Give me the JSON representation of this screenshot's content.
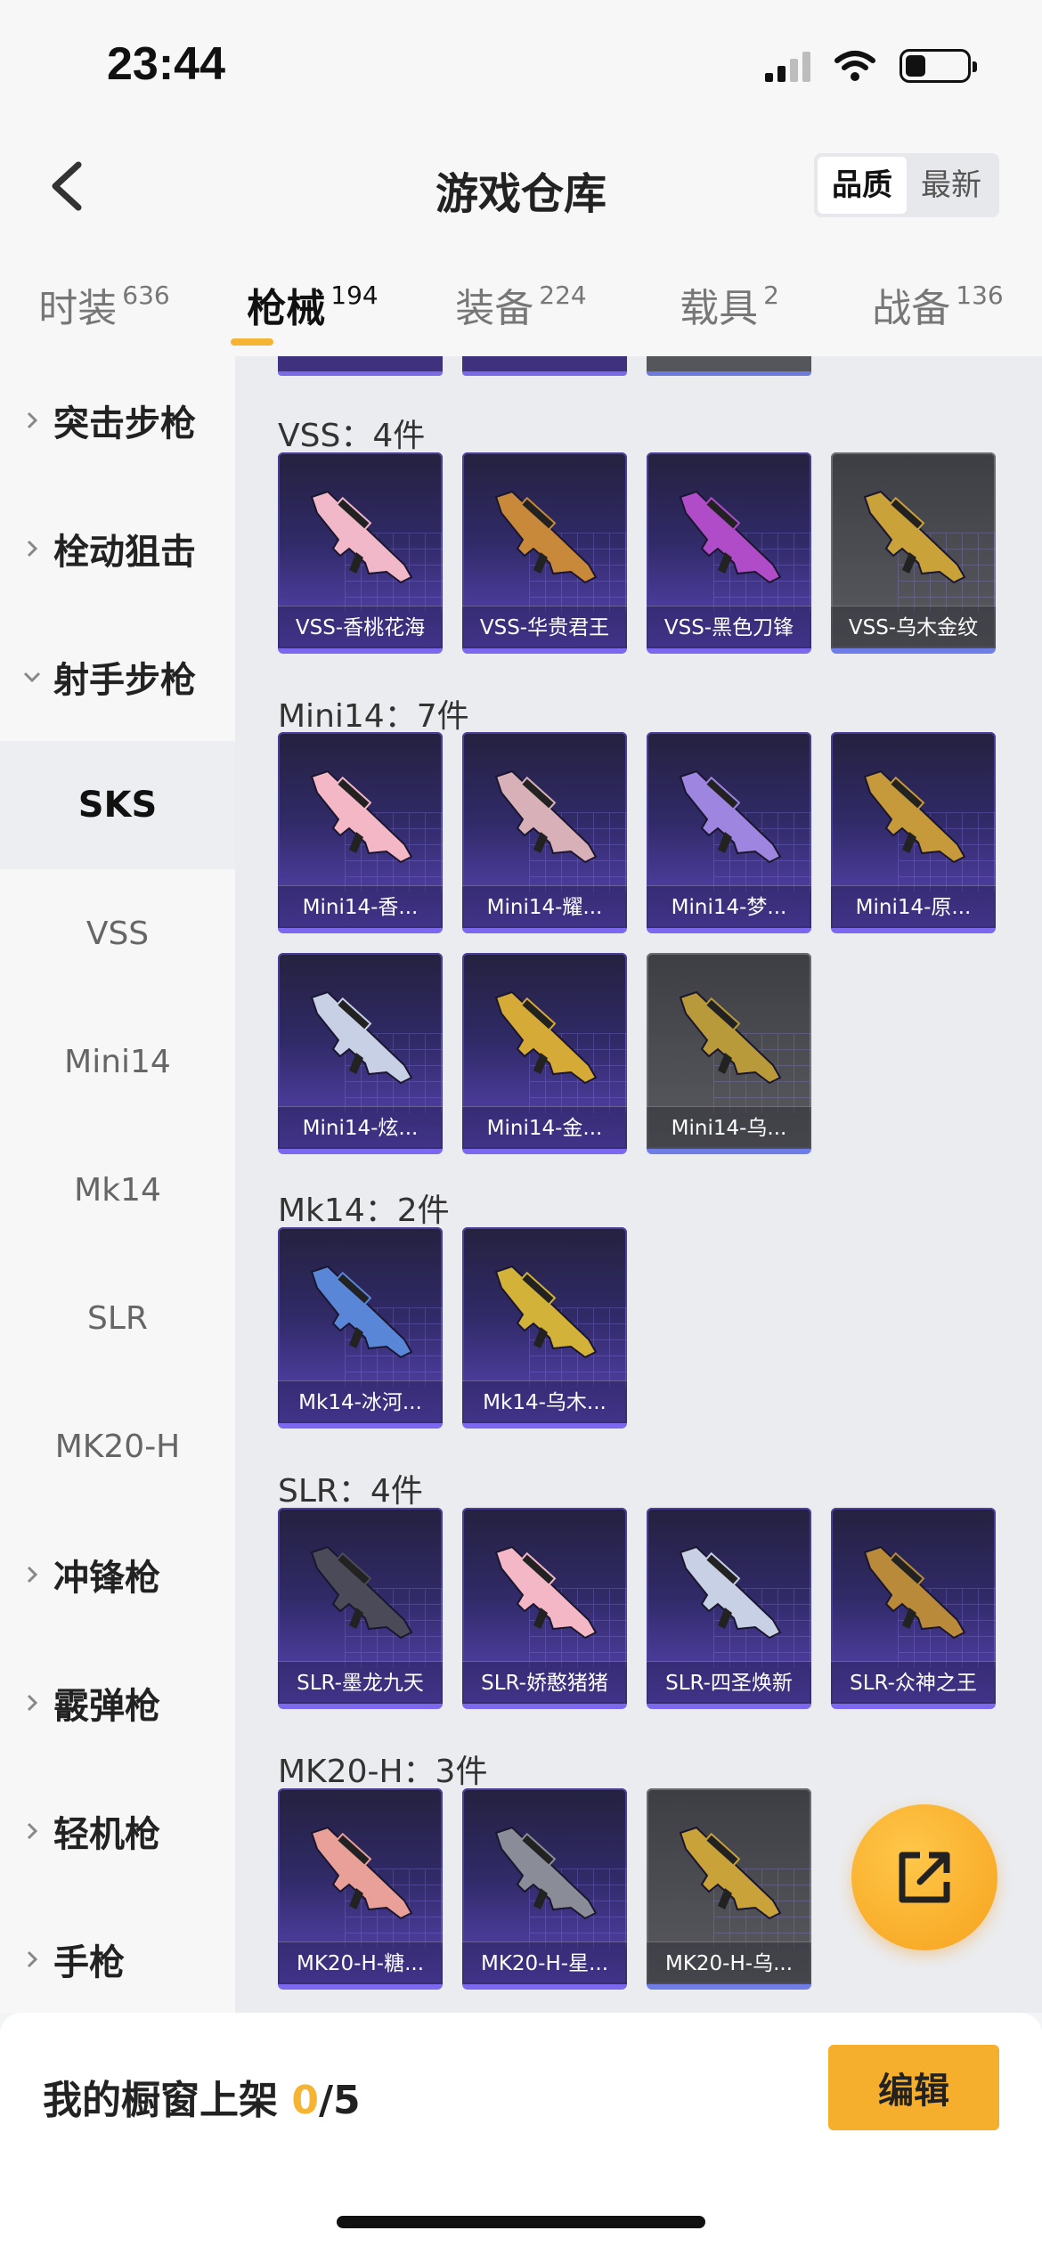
{
  "status_bar": {
    "time": "23:44"
  },
  "header": {
    "title": "游戏仓库",
    "sort_options": [
      "品质",
      "最新"
    ],
    "active_sort": "品质"
  },
  "tabs": [
    {
      "label": "时装",
      "count": "636"
    },
    {
      "label": "枪械",
      "count": "194"
    },
    {
      "label": "装备",
      "count": "224"
    },
    {
      "label": "载具",
      "count": "2"
    },
    {
      "label": "战备",
      "count": "136"
    }
  ],
  "sidebar": {
    "items": [
      {
        "label": "突击步枪",
        "type": "parent",
        "expanded": false
      },
      {
        "label": "栓动狙击",
        "type": "parent",
        "expanded": false
      },
      {
        "label": "射手步枪",
        "type": "parent",
        "expanded": true
      },
      {
        "label": "SKS",
        "type": "child",
        "active": true
      },
      {
        "label": "VSS",
        "type": "child"
      },
      {
        "label": "Mini14",
        "type": "child"
      },
      {
        "label": "Mk14",
        "type": "child"
      },
      {
        "label": "SLR",
        "type": "child"
      },
      {
        "label": "MK20-H",
        "type": "child"
      },
      {
        "label": "冲锋枪",
        "type": "parent",
        "expanded": false
      },
      {
        "label": "霰弹枪",
        "type": "parent",
        "expanded": false
      },
      {
        "label": "轻机枪",
        "type": "parent",
        "expanded": false
      },
      {
        "label": "手枪",
        "type": "parent",
        "expanded": false
      }
    ]
  },
  "groups": [
    {
      "title": "VSS：4件",
      "items": [
        {
          "name": "VSS-香桃花海",
          "color": "#f0b8c8",
          "grey": false
        },
        {
          "name": "VSS-华贵君王",
          "color": "#c88a3a",
          "grey": false
        },
        {
          "name": "VSS-黑色刀锋",
          "color": "#b04cc8",
          "grey": false
        },
        {
          "name": "VSS-乌木金纹",
          "color": "#c9a23a",
          "grey": true
        }
      ]
    },
    {
      "title": "Mini14：7件",
      "items": [
        {
          "name": "Mini14-香...",
          "color": "#f3b7c6",
          "grey": false
        },
        {
          "name": "Mini14-耀...",
          "color": "#d8b0b8",
          "grey": false
        },
        {
          "name": "Mini14-梦...",
          "color": "#9e86e0",
          "grey": false
        },
        {
          "name": "Mini14-原...",
          "color": "#c6993a",
          "grey": false
        },
        {
          "name": "Mini14-炫...",
          "color": "#c8d0e6",
          "grey": false
        },
        {
          "name": "Mini14-金...",
          "color": "#d6aa36",
          "grey": false
        },
        {
          "name": "Mini14-乌...",
          "color": "#b89a3a",
          "grey": true
        }
      ]
    },
    {
      "title": "Mk14：2件",
      "items": [
        {
          "name": "Mk14-冰河...",
          "color": "#5a86d8",
          "grey": false
        },
        {
          "name": "Mk14-乌木...",
          "color": "#d2b238",
          "grey": false
        }
      ]
    },
    {
      "title": "SLR：4件",
      "items": [
        {
          "name": "SLR-墨龙九天",
          "color": "#4a4a58",
          "grey": false
        },
        {
          "name": "SLR-娇憨猪猪",
          "color": "#f3b7c6",
          "grey": false
        },
        {
          "name": "SLR-四圣焕新",
          "color": "#c8d0e6",
          "grey": false
        },
        {
          "name": "SLR-众神之王",
          "color": "#b88a3a",
          "grey": false
        }
      ]
    },
    {
      "title": "MK20-H：3件",
      "items": [
        {
          "name": "MK20-H-糖...",
          "color": "#e8a098",
          "grey": false
        },
        {
          "name": "MK20-H-星...",
          "color": "#8a8c98",
          "grey": false
        },
        {
          "name": "MK20-H-乌...",
          "color": "#c9a23a",
          "grey": true
        }
      ]
    }
  ],
  "bottom_bar": {
    "showcase_label": "我的橱窗上架 ",
    "showcase_count": "0",
    "showcase_total": "/5",
    "edit_label": "编辑"
  },
  "colors": {
    "accent": "#f6ae2d",
    "card_purple": "#3a2f7e",
    "card_grey": "#55565b"
  }
}
